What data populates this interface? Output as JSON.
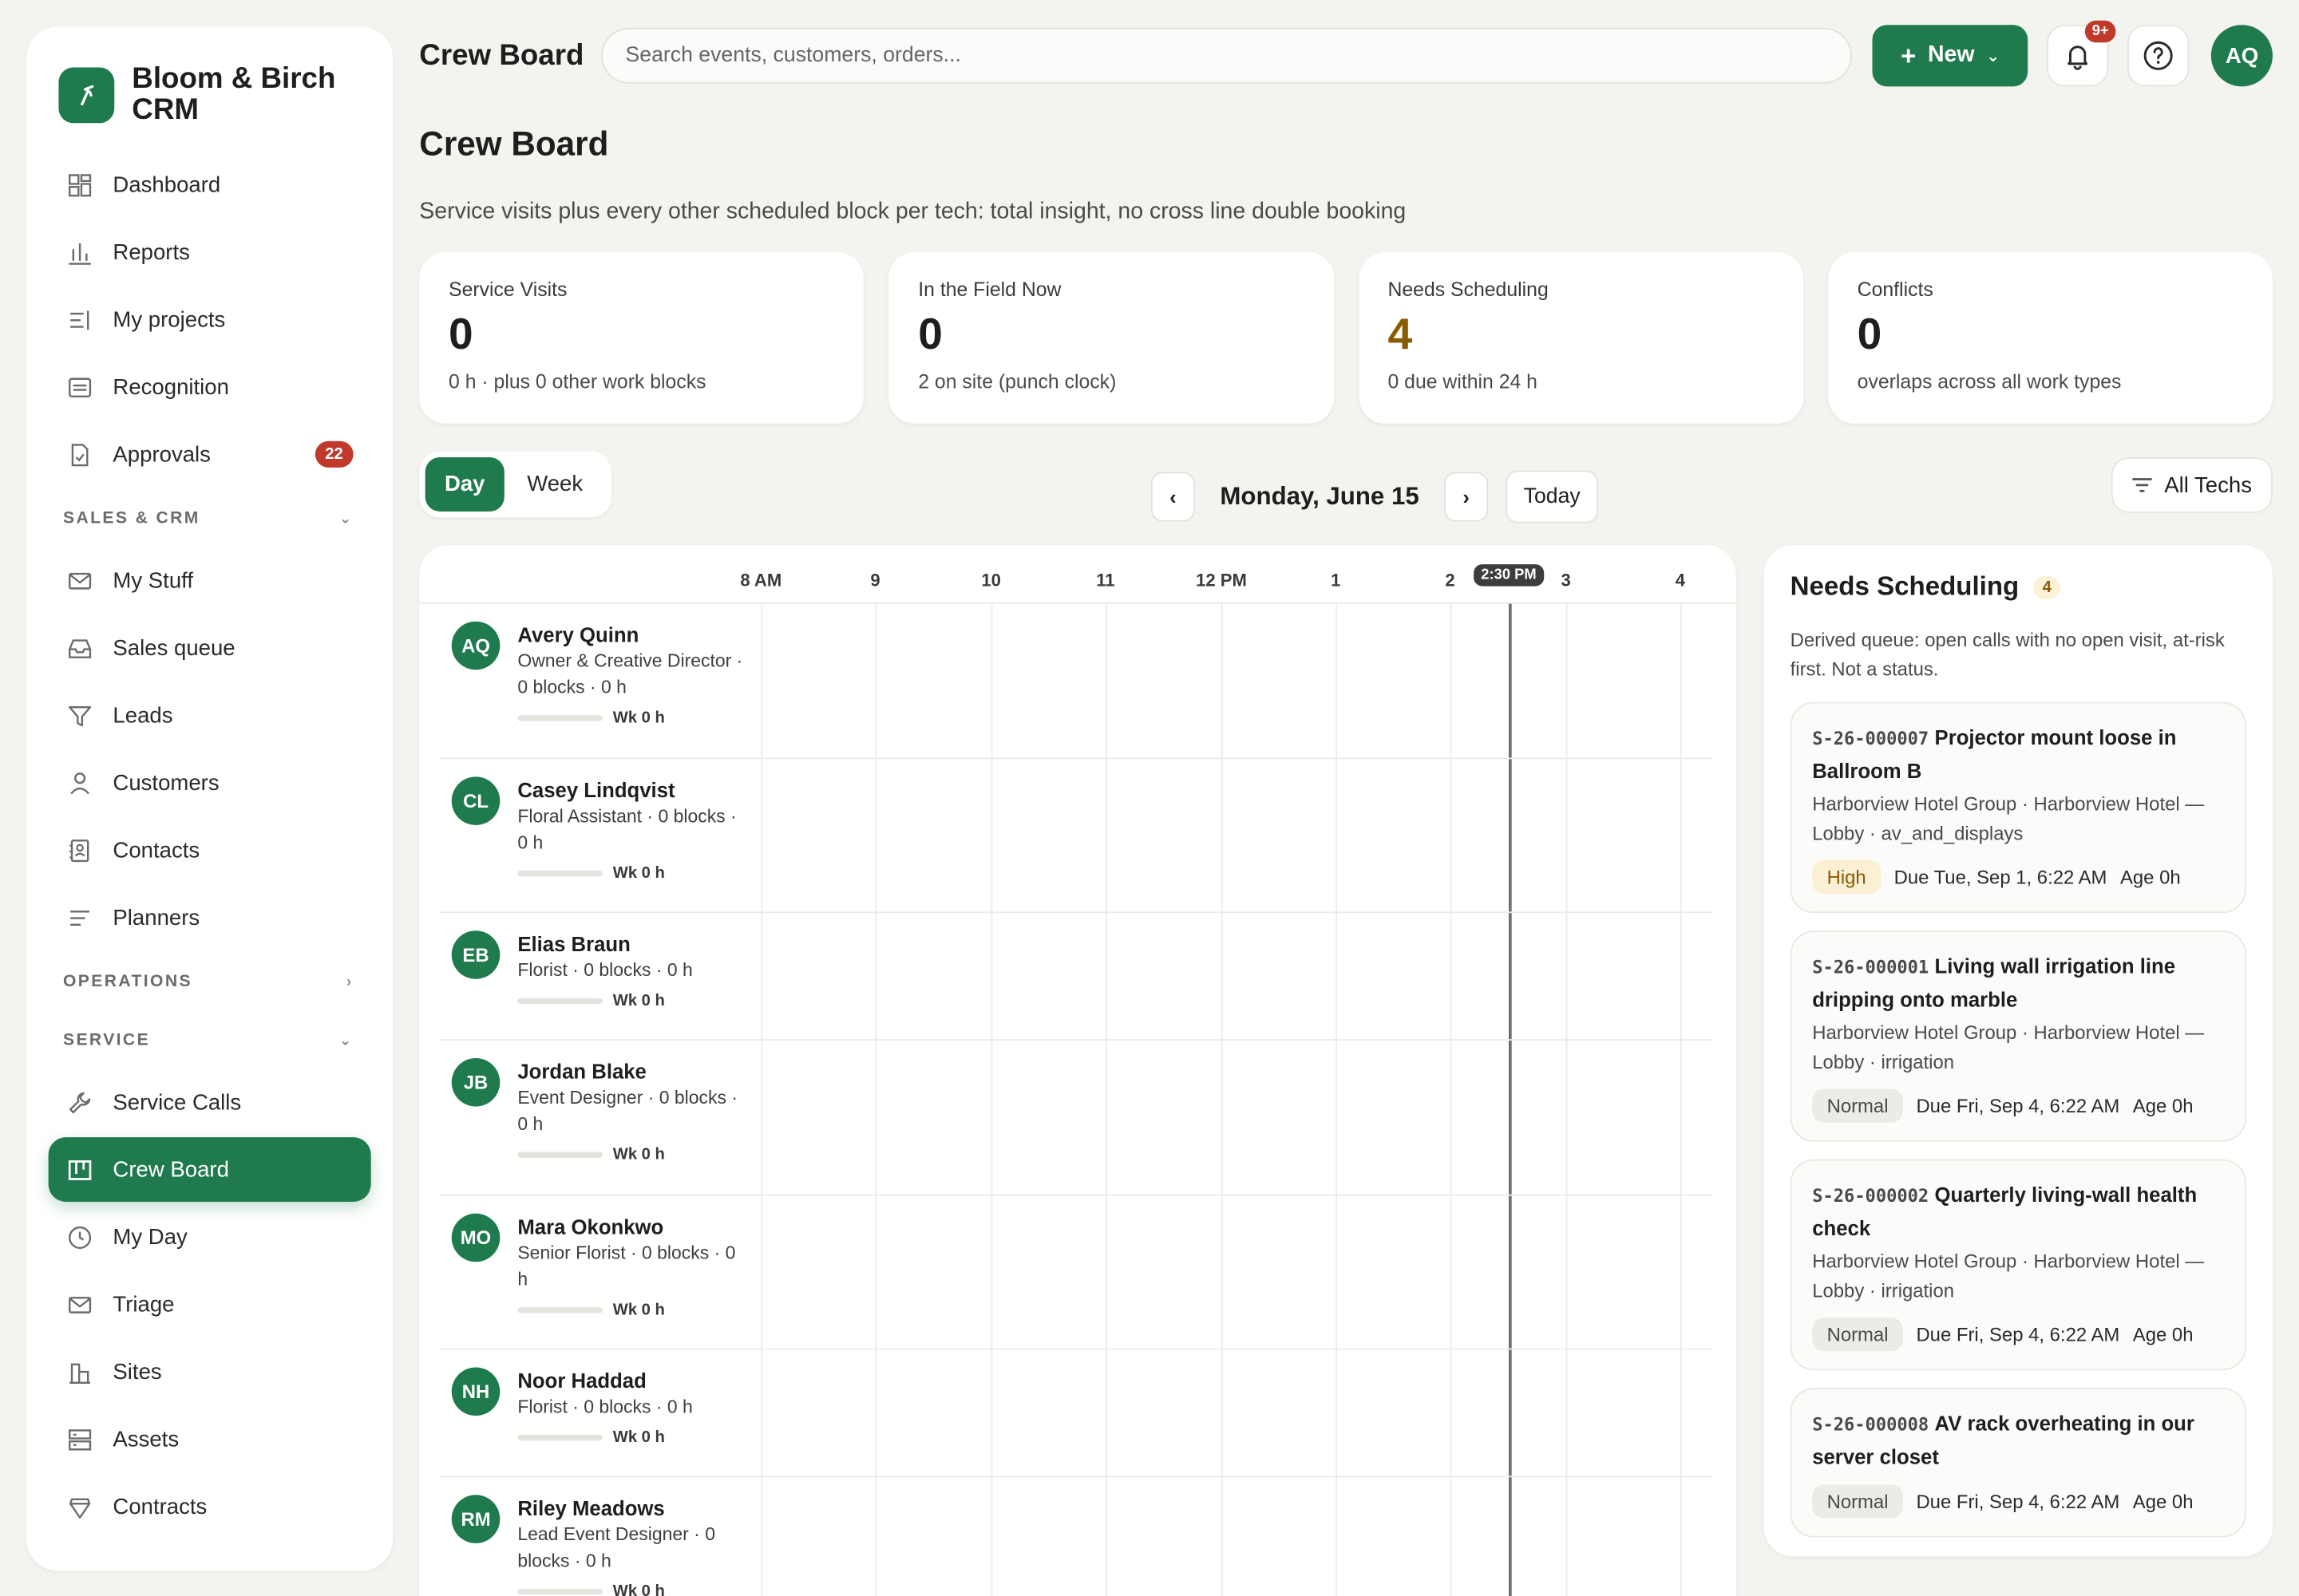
{
  "brand": {
    "name": "Bloom & Birch CRM",
    "logo_icon": "broom-icon"
  },
  "sidebar": {
    "top_items": [
      {
        "label": "Dashboard",
        "icon": "dashboard-icon"
      },
      {
        "label": "Reports",
        "icon": "bar-chart-icon"
      },
      {
        "label": "My projects",
        "icon": "list-icon"
      },
      {
        "label": "Recognition",
        "icon": "card-icon"
      },
      {
        "label": "Approvals",
        "icon": "check-doc-icon",
        "badge": "22"
      }
    ],
    "sections": [
      {
        "label": "SALES & CRM",
        "chevron": "down"
      },
      {
        "label": "OPERATIONS",
        "chevron": "right"
      },
      {
        "label": "SERVICE",
        "chevron": "down"
      }
    ],
    "sales_items": [
      {
        "label": "My Stuff",
        "icon": "mail-icon"
      },
      {
        "label": "Sales queue",
        "icon": "inbox-icon"
      },
      {
        "label": "Leads",
        "icon": "filter-icon"
      },
      {
        "label": "Customers",
        "icon": "person-icon"
      },
      {
        "label": "Contacts",
        "icon": "contact-book-icon"
      },
      {
        "label": "Planners",
        "icon": "lines-icon"
      }
    ],
    "service_items": [
      {
        "label": "Service Calls",
        "icon": "wrench-icon"
      },
      {
        "label": "Crew Board",
        "icon": "board-icon",
        "active": true
      },
      {
        "label": "My Day",
        "icon": "clock-icon"
      },
      {
        "label": "Triage",
        "icon": "mail-icon"
      },
      {
        "label": "Sites",
        "icon": "building-icon"
      },
      {
        "label": "Assets",
        "icon": "server-icon"
      },
      {
        "label": "Contracts",
        "icon": "shield-icon"
      }
    ]
  },
  "topbar": {
    "title": "Crew Board",
    "search_placeholder": "Search events, customers, orders...",
    "new_label": "New",
    "notif_badge": "9+",
    "avatar": "AQ"
  },
  "page": {
    "title": "Crew Board",
    "subtitle": "Service visits plus every other scheduled block per tech: total insight, no cross line double booking"
  },
  "stats": [
    {
      "label": "Service Visits",
      "value": "0",
      "note": "0 h · plus 0 other work blocks"
    },
    {
      "label": "In the Field Now",
      "value": "0",
      "note": "2 on site (punch clock)"
    },
    {
      "label": "Needs Scheduling",
      "value": "4",
      "note": "0 due within 24 h",
      "accent": "#8a5a00"
    },
    {
      "label": "Conflicts",
      "value": "0",
      "note": "overlaps across all work types"
    }
  ],
  "controls": {
    "view_day": "Day",
    "view_week": "Week",
    "date_label": "Monday, June 15",
    "today": "Today",
    "filter": "All Techs"
  },
  "board": {
    "hours": [
      "8 AM",
      "9",
      "10",
      "11",
      "12 PM",
      "1",
      "2",
      "3",
      "4"
    ],
    "now_label": "2:30 PM",
    "techs": [
      {
        "initials": "AQ",
        "name": "Avery Quinn",
        "meta": "Owner & Creative Director · 0 blocks · 0 h",
        "week": "Wk 0 h"
      },
      {
        "initials": "CL",
        "name": "Casey Lindqvist",
        "meta": "Floral Assistant · 0 blocks · 0 h",
        "week": "Wk 0 h"
      },
      {
        "initials": "EB",
        "name": "Elias Braun",
        "meta": "Florist · 0 blocks · 0 h",
        "week": "Wk 0 h"
      },
      {
        "initials": "JB",
        "name": "Jordan Blake",
        "meta": "Event Designer · 0 blocks · 0 h",
        "week": "Wk 0 h"
      },
      {
        "initials": "MO",
        "name": "Mara Okonkwo",
        "meta": "Senior Florist · 0 blocks · 0 h",
        "week": "Wk 0 h"
      },
      {
        "initials": "NH",
        "name": "Noor Haddad",
        "meta": "Florist · 0 blocks · 0 h",
        "week": "Wk 0 h"
      },
      {
        "initials": "RM",
        "name": "Riley Meadows",
        "meta": "Lead Event Designer · 0 blocks · 0 h",
        "week": "Wk 0 h"
      }
    ]
  },
  "needs_scheduling": {
    "title": "Needs Scheduling",
    "count": "4",
    "description": "Derived queue: open calls with no open visit, at-risk first. Not a status.",
    "calls": [
      {
        "id": "S-26-000007",
        "title": "Projector mount loose in Ballroom B",
        "sub": "Harborview Hotel Group · Harborview Hotel — Lobby · av_and_displays",
        "priority": "High",
        "due": "Due Tue, Sep 1, 6:22 AM",
        "age": "Age 0h"
      },
      {
        "id": "S-26-000001",
        "title": "Living wall irrigation line dripping onto marble",
        "sub": "Harborview Hotel Group · Harborview Hotel — Lobby · irrigation",
        "priority": "Normal",
        "due": "Due Fri, Sep 4, 6:22 AM",
        "age": "Age 0h"
      },
      {
        "id": "S-26-000002",
        "title": "Quarterly living-wall health check",
        "sub": "Harborview Hotel Group · Harborview Hotel — Lobby · irrigation",
        "priority": "Normal",
        "due": "Due Fri, Sep 4, 6:22 AM",
        "age": "Age 0h"
      },
      {
        "id": "S-26-000008",
        "title": "AV rack overheating in our server closet",
        "sub": "",
        "priority": "Normal",
        "due": "Due Fri, Sep 4, 6:22 AM",
        "age": "Age 0h"
      }
    ]
  },
  "colors": {
    "accent": "#1f7a4d",
    "badge": "#c0392b",
    "warn": "#8a5a00"
  }
}
